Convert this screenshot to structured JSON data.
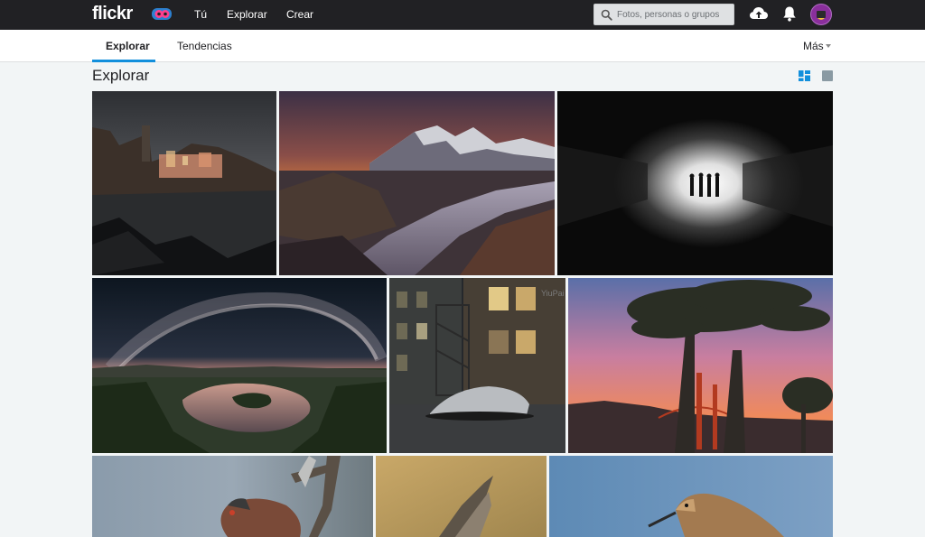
{
  "topnav": {
    "logo": "flickr",
    "links": [
      "Tú",
      "Explorar",
      "Crear"
    ],
    "search_placeholder": "Fotos, personas o grupos",
    "icons": [
      "flickr-pro-badge-icon",
      "search-icon",
      "upload-cloud-icon",
      "notifications-bell-icon",
      "user-avatar"
    ]
  },
  "subnav": {
    "tabs": [
      "Explorar",
      "Tendencias"
    ],
    "active_tab": "Explorar",
    "more_label": "Más",
    "accent_color": "#128fdc"
  },
  "page": {
    "title": "Explorar",
    "view_icons": [
      "justified-view-icon",
      "single-view-icon"
    ]
  },
  "photos": [
    {
      "subject": "Vernazza coastal village at night, dark sea and rocks"
    },
    {
      "subject": "Mountain peaks at sunset over a river"
    },
    {
      "subject": "Silhouettes of people in a bright tunnel exit"
    },
    {
      "subject": "Milky Way arch over a river meander"
    },
    {
      "subject": "Covered car parked in a night street with fire escapes",
      "watermark": "YiuPai"
    },
    {
      "subject": "Cypress trees and Golden Gate Bridge at sunset"
    },
    {
      "subject": "Bird perched on a branch"
    },
    {
      "subject": "Bird in flight"
    },
    {
      "subject": "Sandpiper bird"
    }
  ]
}
